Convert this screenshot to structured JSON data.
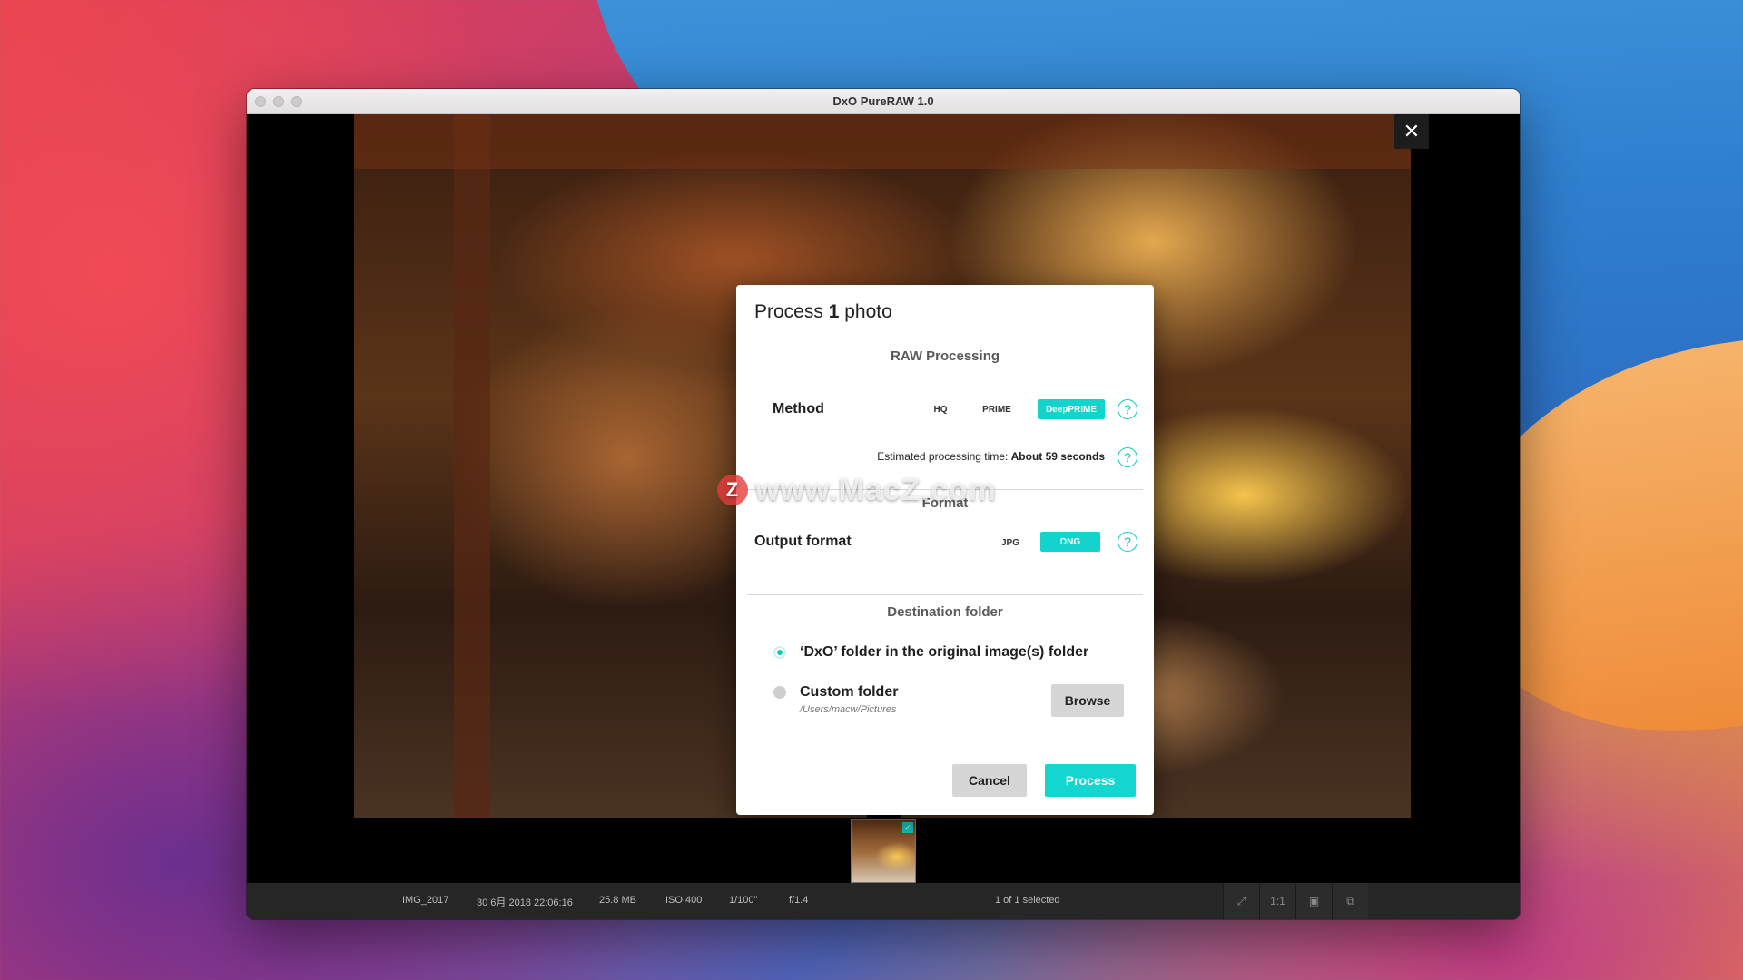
{
  "window": {
    "title": "DxO PureRAW 1.0"
  },
  "viewer": {
    "close_glyph": "✕"
  },
  "dialog": {
    "title_prefix": "Process",
    "title_count": "1",
    "title_suffix": "photo",
    "raw_section": "RAW Processing",
    "method_label": "Method",
    "methods": [
      "HQ",
      "PRIME",
      "DeepPRIME"
    ],
    "method_selected": "DeepPRIME",
    "est_label": "Estimated processing time:",
    "est_value": "About 59 seconds",
    "format_section": "Format",
    "output_label": "Output format",
    "formats": [
      "JPG",
      "DNG"
    ],
    "format_selected": "DNG",
    "dest_section": "Destination folder",
    "option_dxo": "‘DxO’ folder in the original image(s) folder",
    "option_custom": "Custom folder",
    "custom_path": "/Users/macw/Pictures",
    "browse_label": "Browse",
    "cancel_label": "Cancel",
    "process_label": "Process",
    "help_glyph": "?",
    "accent_color": "#14d2cc"
  },
  "statusbar": {
    "filename": "IMG_2017",
    "date": "30 6月 2018 22:06:16",
    "size": "25.8 MB",
    "iso": "ISO 400",
    "shutter": "1/100\"",
    "aperture": "f/1.4",
    "selection": "1 of 1 selected",
    "zoom_label": "1:1"
  },
  "watermark": {
    "logo": "Z",
    "text": "www.MacZ.com"
  }
}
